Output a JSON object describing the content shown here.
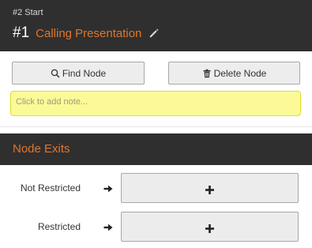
{
  "header": {
    "breadcrumb": "#2 Start",
    "node_number": "#1",
    "node_name": "Calling Presentation",
    "accent_color": "#e0762b",
    "background_color": "#2f2f2f",
    "edit_icon": "pencil-icon"
  },
  "toolbar": {
    "find_label": "Find Node",
    "find_icon": "search-icon",
    "delete_label": "Delete Node",
    "delete_icon": "trash-icon"
  },
  "note": {
    "placeholder": "Click to add note...",
    "background_color": "#fbfa96"
  },
  "exits": {
    "title": "Node Exits",
    "items": [
      {
        "label": "Not Restricted",
        "arrow_icon": "arrow-right-icon",
        "add_icon": "plus-icon"
      },
      {
        "label": "Restricted",
        "arrow_icon": "arrow-right-icon",
        "add_icon": "plus-icon"
      }
    ]
  }
}
